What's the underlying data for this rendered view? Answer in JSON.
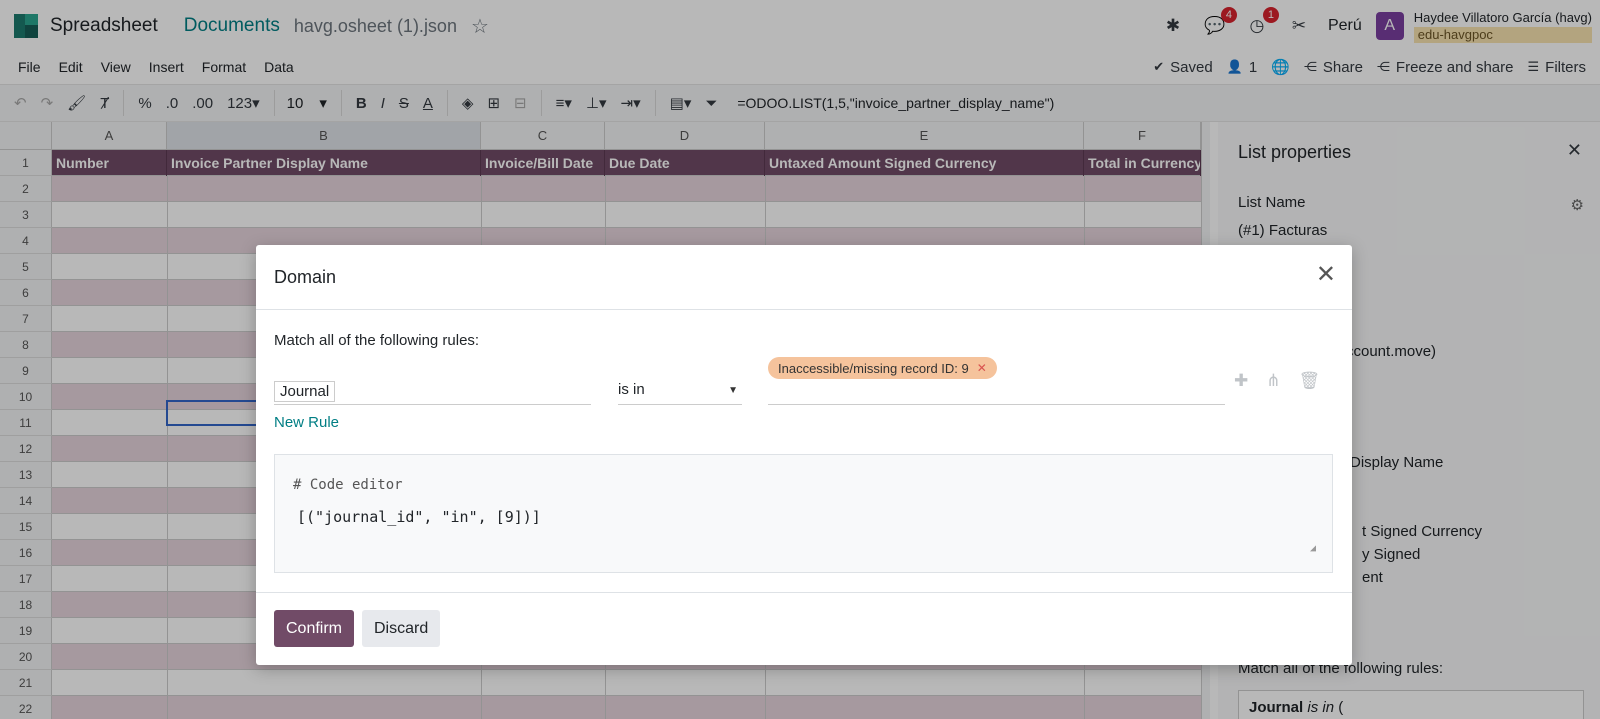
{
  "topbar": {
    "app_name": "Spreadsheet",
    "breadcrumb_documents": "Documents",
    "file_name": "havg.osheet (1).json",
    "chat_badge": "4",
    "activity_badge": "1",
    "country": "Perú",
    "avatar_letter": "A",
    "user_name": "Haydee Villatoro García (havg)",
    "user_db": "edu-havgpoc"
  },
  "menubar": {
    "items": [
      "File",
      "Edit",
      "View",
      "Insert",
      "Format",
      "Data"
    ],
    "saved": "Saved",
    "users_count": "1",
    "share": "Share",
    "freeze_share": "Freeze and share",
    "filters": "Filters"
  },
  "toolbar": {
    "percent": "%",
    "dec_decimals": ".0",
    "inc_decimals": ".00",
    "more_formats": "123",
    "font_size": "10",
    "formula": "=ODOO.LIST(1,5,\"invoice_partner_display_name\")"
  },
  "grid": {
    "columns": [
      "A",
      "B",
      "C",
      "D",
      "E",
      "F"
    ],
    "rows": [
      "1",
      "2",
      "3",
      "4",
      "5",
      "6",
      "7",
      "8",
      "9",
      "10",
      "11",
      "12",
      "13",
      "14",
      "15",
      "16",
      "17",
      "18",
      "19",
      "20",
      "21",
      "22"
    ],
    "header_cells": [
      "Number",
      "Invoice Partner Display Name",
      "Invoice/Bill Date",
      "Due Date",
      "Untaxed Amount Signed Currency",
      "Total in Currency"
    ]
  },
  "side_panel": {
    "title": "List properties",
    "list_name_label": "List Name",
    "list_name_value": "(#1) Facturas",
    "frag_model": "ccount.move)",
    "frag_display": "Display Name",
    "frag_signed_currency": "t Signed Currency",
    "frag_signed": "y Signed",
    "frag_ent": "ent",
    "rules_label": "Match all of the following rules:",
    "domain_field": "Journal",
    "domain_op": "is in",
    "domain_rest": "("
  },
  "modal": {
    "title": "Domain",
    "rules_label": "Match all of the following rules:",
    "field": "Journal",
    "operator": "is in",
    "tag": "Inaccessible/missing record ID: 9",
    "new_rule": "New Rule",
    "code_comment": "# Code editor",
    "code": "[(\"journal_id\", \"in\", [9])]",
    "confirm": "Confirm",
    "discard": "Discard"
  }
}
